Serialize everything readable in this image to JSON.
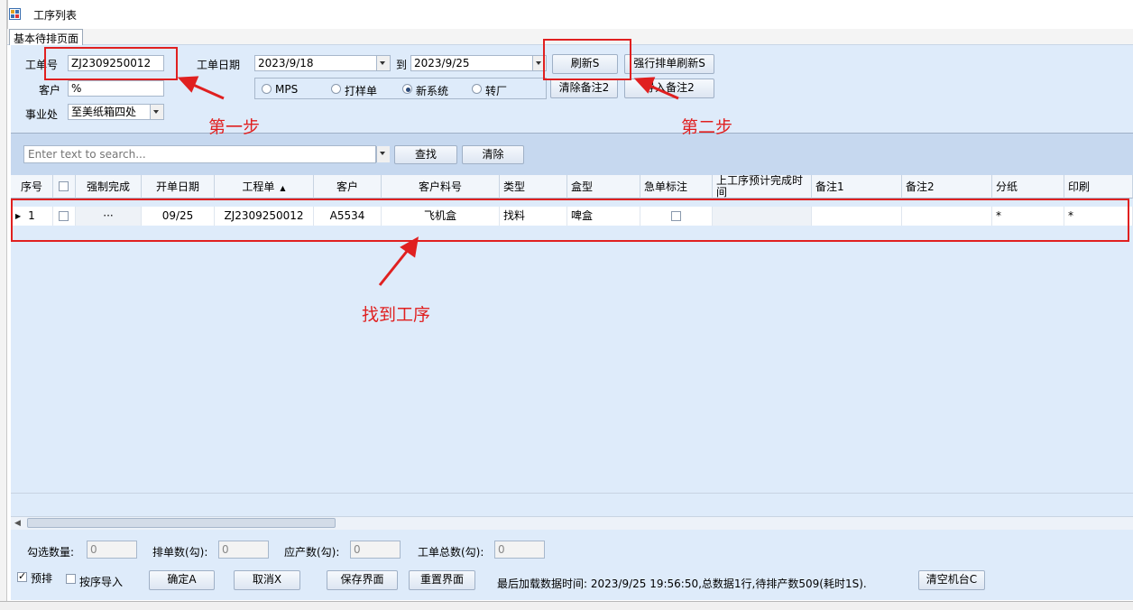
{
  "window": {
    "title": "工序列表"
  },
  "tabs": [
    {
      "label": "基本待排页面"
    }
  ],
  "form": {
    "order_no_label": "工单号",
    "order_no_value": "ZJ2309250012",
    "customer_label": "客户",
    "customer_value": "%",
    "division_label": "事业处",
    "division_value": "至美纸箱四处",
    "date_label": "工单日期",
    "date_from": "2023/9/18",
    "date_to_label": "到",
    "date_to": "2023/9/25",
    "radio_options": [
      {
        "label": "MPS",
        "selected": false
      },
      {
        "label": "打样单",
        "selected": false
      },
      {
        "label": "新系统",
        "selected": true
      },
      {
        "label": "转厂",
        "selected": false
      }
    ],
    "refresh_label": "刷新S",
    "force_refresh_label": "强行排单刷新S",
    "clear_remark2_label": "清除备注2",
    "import_remark2_label": "导入备注2"
  },
  "search": {
    "placeholder": "Enter text to search...",
    "find_label": "查找",
    "clear_label": "清除"
  },
  "table": {
    "columns": [
      "序号",
      "",
      "强制完成",
      "开单日期",
      "工程单",
      "客户",
      "客户料号",
      "类型",
      "盒型",
      "急单标注",
      "上工序预计完成时间",
      "备注1",
      "备注2",
      "分纸",
      "印刷"
    ],
    "rows": [
      {
        "seq": "1",
        "checked": false,
        "force": "···",
        "date": "09/25",
        "order": "ZJ2309250012",
        "customer": "A5534",
        "part_no": "飞机盒",
        "type": "找料",
        "box": "啤盒",
        "urgent": false,
        "prev_time": "",
        "remark1": "",
        "remark2": "",
        "split": "*",
        "print": "*"
      }
    ]
  },
  "footer": {
    "selected_count_label": "勾选数量:",
    "selected_count": "0",
    "scheduled_label": "排单数(勾):",
    "scheduled": "0",
    "production_label": "应产数(勾):",
    "production": "0",
    "total_label": "工单总数(勾):",
    "total": "0",
    "pre_schedule_label": "预排",
    "pre_schedule_checked": true,
    "process_import_label": "按序导入",
    "process_import_checked": false,
    "confirm_label": "确定A",
    "cancel_label": "取消X",
    "save_label": "保存界面",
    "reset_label": "重置界面",
    "status_text": "最后加载数据时间: 2023/9/25 19:56:50,总数据1行,待排产数509(耗时1S).",
    "clear_machine_label": "清空机台C"
  },
  "annotations": {
    "step1": "第一步",
    "step2": "第二步",
    "find_process": "找到工序"
  },
  "colors": {
    "annotation": "#e02020",
    "panel": "#deebfa",
    "header": "#c6d8ef"
  }
}
